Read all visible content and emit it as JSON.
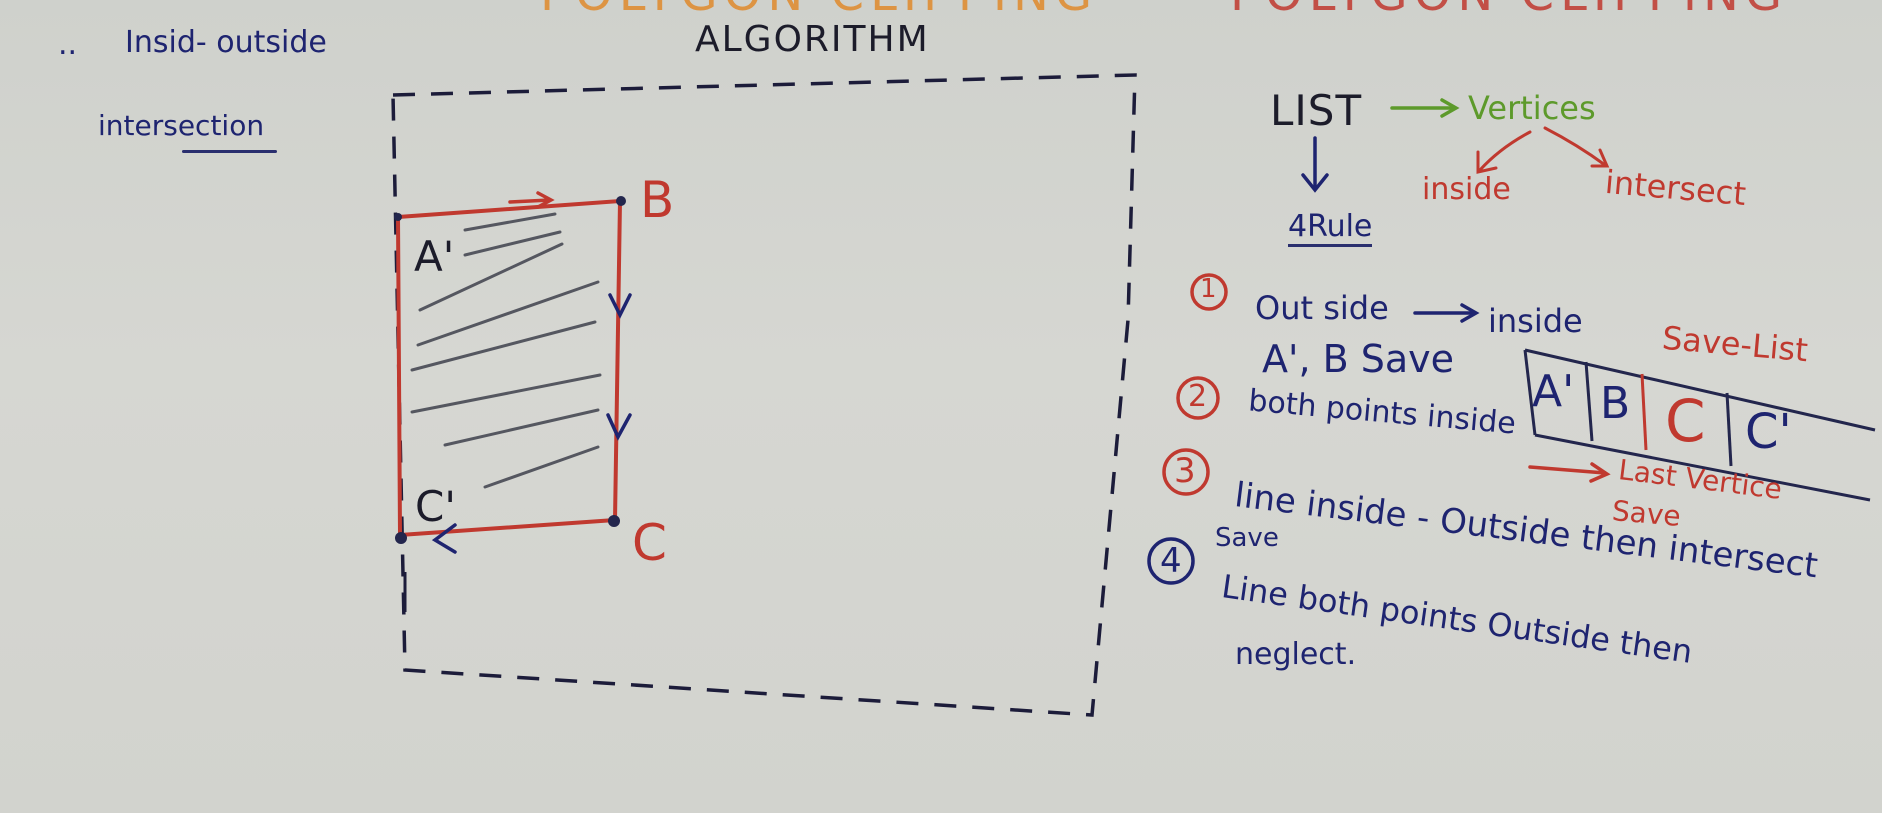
{
  "top_titles": {
    "left_partial": "POLYGON CLIPPING",
    "right_partial": "POLYGON CLIPPING"
  },
  "algorithm_heading": "ALGORITHM",
  "left_notes": {
    "bullet": "..",
    "line1": "Insid- outside",
    "line2": "intersection"
  },
  "points": {
    "a_prime": "A'",
    "b": "B",
    "c": "C",
    "c_prime": "C'"
  },
  "list_tree": {
    "root": "LIST",
    "vertices": "Vertices",
    "inside": "inside",
    "intersect": "intersect",
    "rule": "4Rule"
  },
  "rules": [
    {
      "num": "1",
      "text": "Out side",
      "result": "inside",
      "detail": "A', B Save"
    },
    {
      "num": "2",
      "text": "both points inside",
      "result": "Last Vertice",
      "detail": "Save"
    },
    {
      "num": "3",
      "text": "line inside - Outside then intersect",
      "detail": "Save"
    },
    {
      "num": "4",
      "text": "Line both points Outside then",
      "detail": "neglect."
    }
  ],
  "save_list": {
    "label": "Save-List",
    "cells": [
      "A'",
      "B",
      "C",
      "C'"
    ]
  },
  "colors": {
    "red": "#c0392f",
    "blue": "#1e2470",
    "green": "#5d9a2b",
    "board": "#d3d4cf"
  }
}
